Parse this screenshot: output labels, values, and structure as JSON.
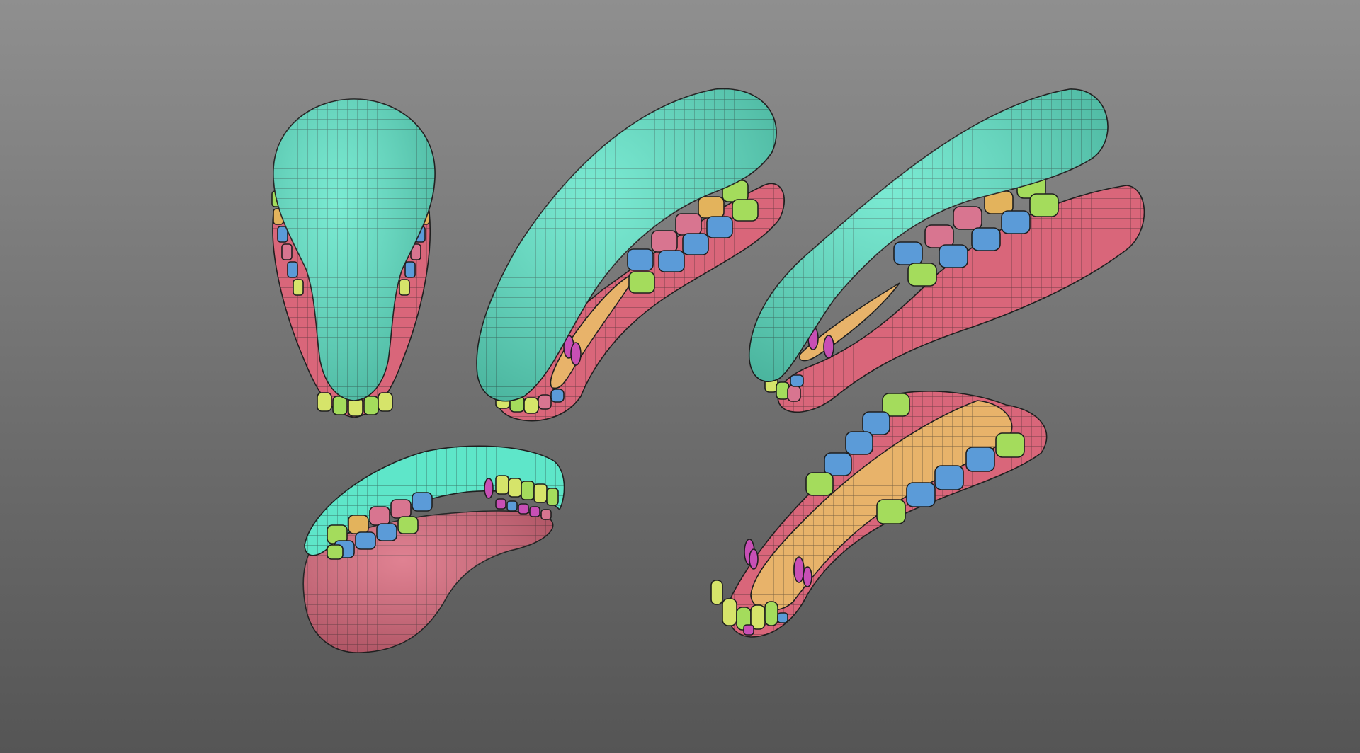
{
  "scene": {
    "subject": "jaw-topology-views",
    "view_count": 5,
    "background_colors": [
      "#8f8f8f",
      "#555555"
    ]
  },
  "materials": {
    "upper_jaw": "#5ee6c9",
    "lower_jaw": "#d9667a",
    "tongue": "#e8b36a",
    "tooth_green": "#a4dc5c",
    "tooth_blue": "#5b9bd8",
    "tooth_pink": "#d87590",
    "tooth_orange": "#e3b35c",
    "tooth_yellow": "#d6e46a",
    "claw_magenta": "#c84fb5",
    "wireframe": "#1f1f1f"
  },
  "views": [
    {
      "id": "front",
      "parts": [
        "upper_jaw",
        "lower_jaw",
        "teeth"
      ]
    },
    {
      "id": "side-left",
      "parts": [
        "upper_jaw",
        "lower_jaw",
        "tongue",
        "teeth"
      ]
    },
    {
      "id": "side-right",
      "parts": [
        "upper_jaw",
        "lower_jaw",
        "tongue",
        "teeth"
      ]
    },
    {
      "id": "open-mouth",
      "parts": [
        "upper_jaw",
        "lower_jaw",
        "teeth"
      ]
    },
    {
      "id": "lower-jaw-top",
      "parts": [
        "lower_jaw",
        "tongue",
        "teeth"
      ]
    }
  ]
}
